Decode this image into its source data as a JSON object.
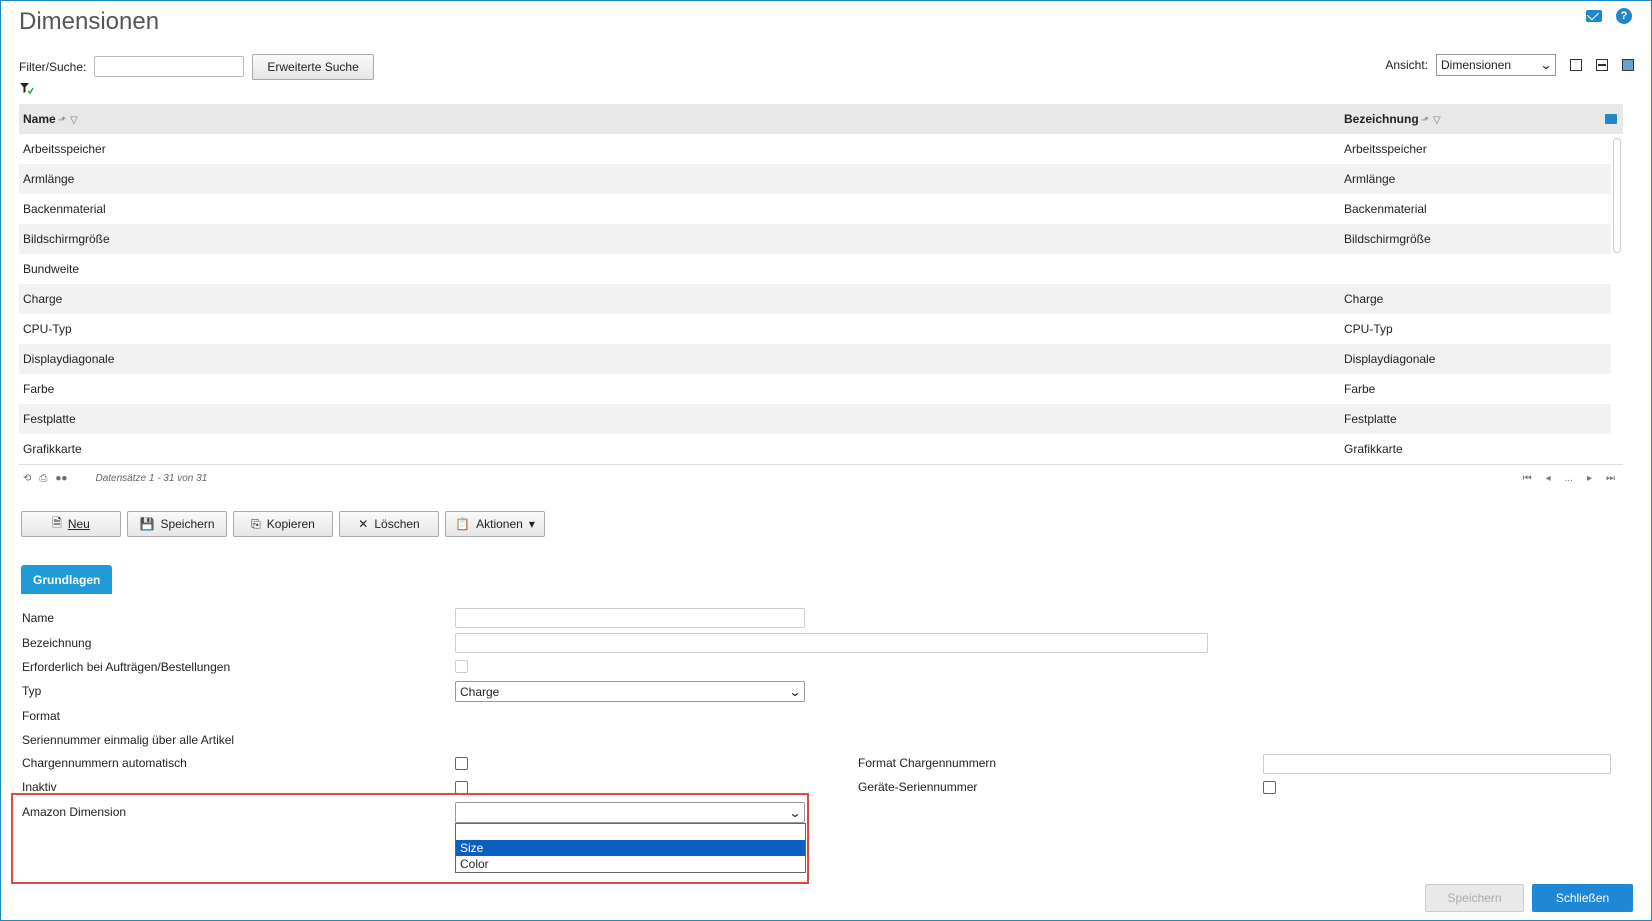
{
  "header": {
    "title": "Dimensionen"
  },
  "filter": {
    "label": "Filter/Suche:",
    "input_value": "",
    "advanced_button": "Erweiterte Suche",
    "view_label": "Ansicht:",
    "view_value": "Dimensionen"
  },
  "grid": {
    "columns": [
      "Name",
      "Bezeichnung"
    ],
    "rows": [
      {
        "name": "Arbeitsspeicher",
        "bezeichnung": "Arbeitsspeicher"
      },
      {
        "name": "Armlänge",
        "bezeichnung": "Armlänge"
      },
      {
        "name": "Backenmaterial",
        "bezeichnung": "Backenmaterial"
      },
      {
        "name": "Bildschirmgröße",
        "bezeichnung": "Bildschirmgröße"
      },
      {
        "name": "Bundweite",
        "bezeichnung": ""
      },
      {
        "name": "Charge",
        "bezeichnung": "Charge"
      },
      {
        "name": "CPU-Typ",
        "bezeichnung": "CPU-Typ"
      },
      {
        "name": "Displaydiagonale",
        "bezeichnung": "Displaydiagonale"
      },
      {
        "name": "Farbe",
        "bezeichnung": "Farbe"
      },
      {
        "name": "Festplatte",
        "bezeichnung": "Festplatte"
      },
      {
        "name": "Grafikkarte",
        "bezeichnung": "Grafikkarte"
      }
    ],
    "records": "Datensätze 1 - 31 von 31",
    "pager_ellipsis": "..."
  },
  "actions": {
    "new": "Neu",
    "save": "Speichern",
    "copy": "Kopieren",
    "delete": "Löschen",
    "actions": "Aktionen"
  },
  "tab": {
    "label": "Grundlagen"
  },
  "form": {
    "name_label": "Name",
    "name_value": "",
    "bezeichnung_label": "Bezeichnung",
    "bezeichnung_value": "",
    "required_label": "Erforderlich bei Aufträgen/Bestellungen",
    "typ_label": "Typ",
    "typ_value": "Charge",
    "format_label": "Format",
    "serial_unique_label": "Seriennummer einmalig über alle Artikel",
    "charge_auto_label": "Chargennummern automatisch",
    "format_charge_label": "Format Chargennummern",
    "format_charge_value": "",
    "inaktiv_label": "Inaktiv",
    "device_serial_label": "Geräte-Seriennummer",
    "amazon_label": "Amazon Dimension",
    "amazon_value": "",
    "amazon_options": [
      "",
      "Size",
      "Color"
    ]
  },
  "footer": {
    "save": "Speichern",
    "close": "Schließen"
  },
  "colors": {
    "accent": "#1e88c9",
    "tab": "#1e9ad6",
    "highlight": "#e04848",
    "selected_option": "#0b5fbf"
  }
}
